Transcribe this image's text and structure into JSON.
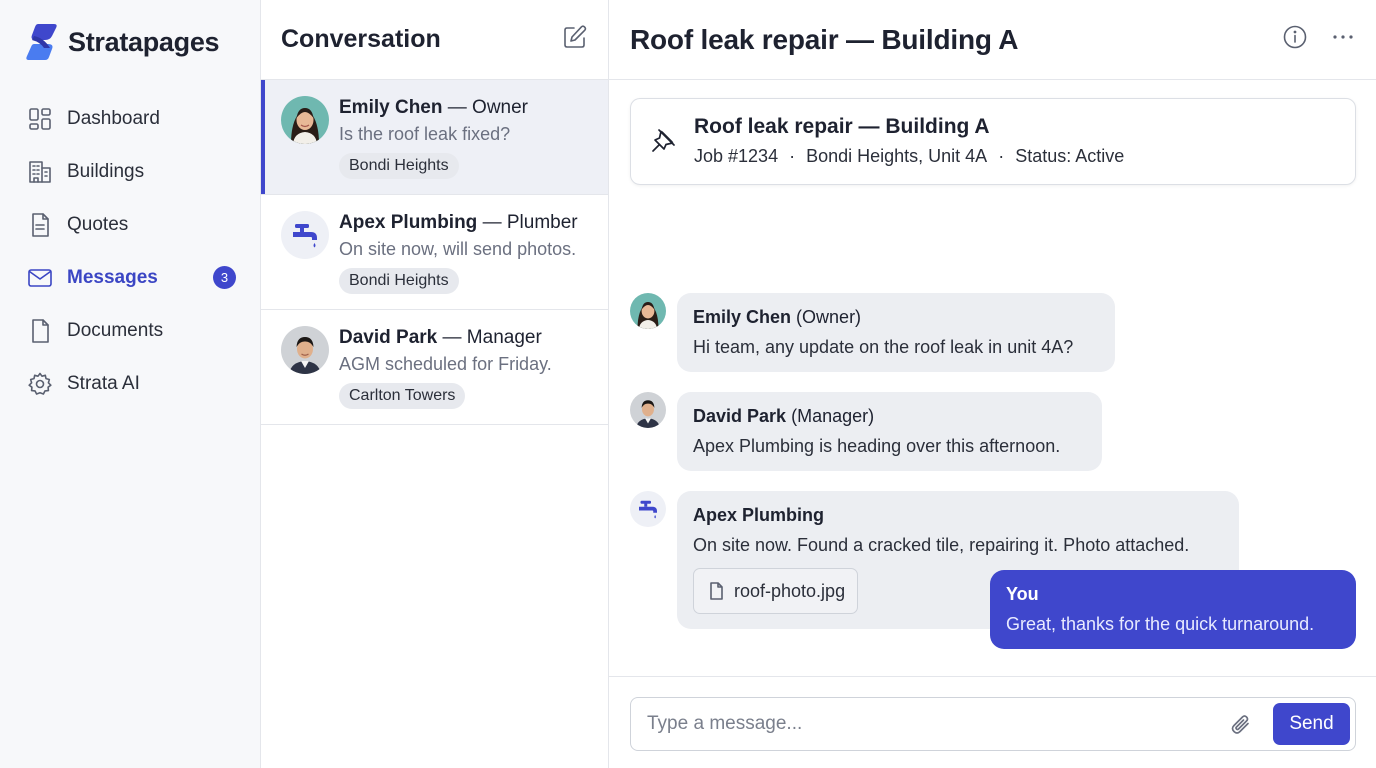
{
  "app": {
    "name": "Stratapages",
    "brand_color": "#3f47cc"
  },
  "sidebar": {
    "items": [
      {
        "label": "Dashboard",
        "icon": "dashboard-icon",
        "active": false
      },
      {
        "label": "Buildings",
        "icon": "building-icon",
        "active": false
      },
      {
        "label": "Quotes",
        "icon": "quote-document-icon",
        "active": false
      },
      {
        "label": "Messages",
        "icon": "mail-icon",
        "active": true,
        "badge": "3"
      },
      {
        "label": "Documents",
        "icon": "document-icon",
        "active": false
      },
      {
        "label": "Strata AI",
        "icon": "gear-icon",
        "active": false
      }
    ]
  },
  "conversations": {
    "title": "Conversation",
    "compose_icon": "compose-icon",
    "items": [
      {
        "name": "Emily Chen",
        "role": "— Owner",
        "preview": "Is the roof leak fixed?",
        "tag": "Bondi Heights",
        "active": true,
        "avatar": "avatar-photo"
      },
      {
        "name": "Apex Plumbing",
        "role": "— Plumber",
        "preview": "On site now, will send photos.",
        "tag": "Bondi Heights",
        "active": false,
        "avatar": "faucet-icon"
      },
      {
        "name": "David Park",
        "role": "— Manager",
        "preview": "AGM scheduled for Friday.",
        "tag": "Carlton Towers",
        "active": false,
        "avatar": "avatar-photo"
      }
    ]
  },
  "chat": {
    "title": "Roof leak repair — Building A",
    "pinned": {
      "title": "Roof leak repair — Building A",
      "job": "Job #1234",
      "location": "Bondi Heights, Unit 4A",
      "status": "Status: Active",
      "separator": "·"
    },
    "messages": [
      {
        "sender": "Emily Chen",
        "role": "(Owner)",
        "text": "Hi team, any update on the roof leak in unit 4A?"
      },
      {
        "sender": "David Park",
        "role": "(Manager)",
        "text": "Apex Plumbing is heading over this afternoon."
      },
      {
        "sender": "Apex Plumbing",
        "role": "",
        "text": "On site now. Found a cracked tile, repairing it. Photo attached.",
        "attachment": "roof-photo.jpg"
      },
      {
        "sender": "You",
        "role": "",
        "text": "Great, thanks for the quick turnaround."
      }
    ],
    "composer": {
      "placeholder": "Type a message...",
      "value": "",
      "send_label": "Send"
    }
  }
}
